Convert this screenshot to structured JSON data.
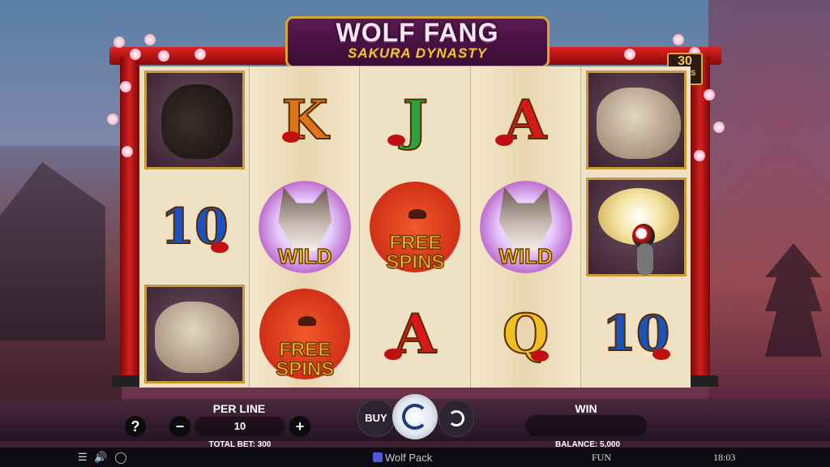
{
  "game": {
    "title": "WOLF FANG",
    "subtitle": "SAKURA DYNASTY",
    "lines_count": "30",
    "lines_label": "LINES"
  },
  "reels": [
    [
      "bear",
      "ten",
      "glider"
    ],
    [
      "k",
      "wild",
      "free_spins"
    ],
    [
      "j",
      "free_spins",
      "a"
    ],
    [
      "a",
      "wild",
      "q"
    ],
    [
      "glider",
      "crane",
      "ten"
    ]
  ],
  "symbols": {
    "k": "K",
    "j": "J",
    "a": "A",
    "q": "Q",
    "ten": "10",
    "wild": "WILD",
    "free_line1": "FREE",
    "free_line2": "SPINS"
  },
  "controls": {
    "help": "?",
    "minus": "−",
    "plus": "+",
    "per_line_label": "PER LINE",
    "per_line_value": "10",
    "total_bet": "TOTAL BET: 300",
    "buy": "BUY",
    "win_label": "WIN",
    "win_value": "",
    "balance": "BALANCE: 5,000"
  },
  "status": {
    "menu_icon": "☰",
    "sound_icon": "🔊",
    "brand": "Wolf Pack",
    "mode": "FUN",
    "time": "18:03"
  },
  "colors": {
    "gate_red": "#d42020",
    "gold": "#d6a63a",
    "wild_text": "#f2c530"
  }
}
